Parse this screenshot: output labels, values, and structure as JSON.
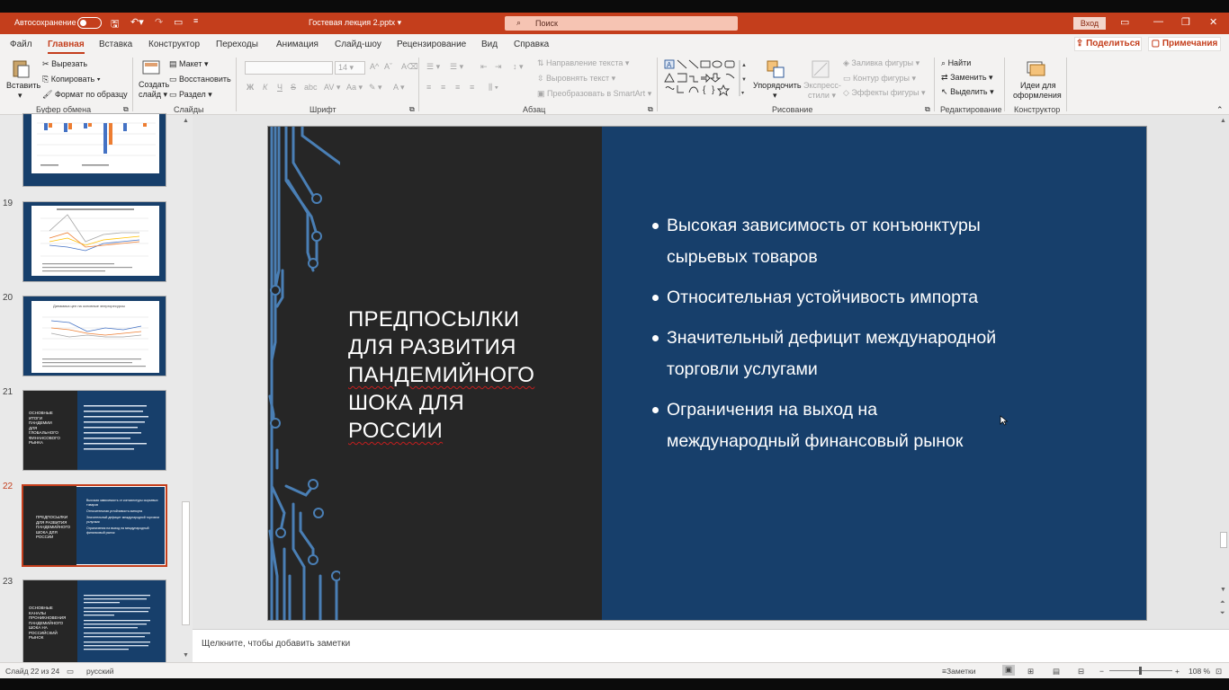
{
  "titlebar": {
    "autosave_label": "Автосохранение",
    "doc_title": "Гостевая лекция 2.pptx",
    "search_placeholder": "Поиск",
    "signin": "Вход"
  },
  "tabs": [
    "Файл",
    "Главная",
    "Вставка",
    "Конструктор",
    "Переходы",
    "Анимация",
    "Слайд-шоу",
    "Рецензирование",
    "Вид",
    "Справка"
  ],
  "active_tab": "Главная",
  "share_label": "Поделиться",
  "comments_label": "Примечания",
  "ribbon": {
    "clipboard": {
      "paste": "Вставить",
      "cut": "Вырезать",
      "copy": "Копировать",
      "format_painter": "Формат по образцу",
      "group": "Буфер обмена"
    },
    "slides": {
      "new_slide_1": "Создать",
      "new_slide_2": "слайд",
      "layout": "Макет",
      "reset": "Восстановить",
      "section": "Раздел",
      "group": "Слайды"
    },
    "font": {
      "size": "14",
      "bold": "Ж",
      "italic": "К",
      "underline": "Ч",
      "strike": "S",
      "shadow": "abc",
      "group": "Шрифт"
    },
    "paragraph": {
      "text_direction": "Направление текста",
      "align_text": "Выровнять текст",
      "smartart": "Преобразовать в SmartArt",
      "group": "Абзац"
    },
    "drawing": {
      "arrange": "Упорядочить",
      "quick_styles_1": "Экспресс-",
      "quick_styles_2": "стили",
      "shape_fill": "Заливка фигуры",
      "shape_outline": "Контур фигуры",
      "shape_effects": "Эффекты фигуры",
      "group": "Рисование"
    },
    "editing": {
      "find": "Найти",
      "replace": "Заменить",
      "select": "Выделить",
      "group": "Редактирование"
    },
    "designer": {
      "ideas_1": "Идеи для",
      "ideas_2": "оформления",
      "group": "Конструктор"
    }
  },
  "thumbnails": [
    {
      "num": "19"
    },
    {
      "num": "20",
      "caption": "Динамика цен на основные энергоресурсы"
    },
    {
      "num": "21",
      "title": [
        "ОСНОВНЫЕ",
        "ИТОГИ",
        "ПАНДЕМИИ",
        "ДЛЯ",
        "ГЛОБАЛЬНОГО",
        "ФИНАНСОВОГО",
        "РЫНКА"
      ]
    },
    {
      "num": "22",
      "title": [
        "ПРЕДПОСЫЛКИ",
        "ДЛЯ РАЗВИТИЯ",
        "ПАНДЕМИЙНОГО",
        "ШОКА ДЛЯ",
        "РОССИИ"
      ],
      "bullets": [
        "Высокая зависимость от конъюнктуры сырьевых товаров",
        "Относительная устойчивость импорта",
        "Значительный дефицит международной торговли услугами",
        "Ограничения на выход на международный финансовый рынок"
      ]
    },
    {
      "num": "23",
      "title": [
        "ОСНОВНЫЕ",
        "КАНАЛЫ",
        "ПРОНИКНОВЕНИЯ",
        "ПАНДЕМИЙНОГО",
        "ШОКА НА",
        "РОССИЙСКИЙ",
        "РЫНОК"
      ]
    }
  ],
  "slide": {
    "title_lines": [
      "ПРЕДПОСЫЛКИ",
      "ДЛЯ РАЗВИТИЯ",
      "ПАНДЕМИЙНОГО",
      "ШОКА ДЛЯ",
      "РОССИИ"
    ],
    "bullets": [
      [
        "Высокая зависимость от конъюнктуры",
        "сырьевых товаров"
      ],
      [
        "Относительная устойчивость импорта"
      ],
      [
        "Значительный дефицит международной",
        "торговли услугами"
      ],
      [
        "Ограничения на выход на",
        "международный финансовый рынок"
      ]
    ]
  },
  "notes_placeholder": "Щелкните, чтобы добавить заметки",
  "status": {
    "slide_count": "Слайд 22 из 24",
    "language": "русский",
    "notes": "Заметки",
    "zoom": "108 %"
  },
  "colors": {
    "accent": "#c43e1c",
    "slide_bg": "#173f6b",
    "slide_dark": "#262626",
    "circuit": "#4a7fb5"
  }
}
